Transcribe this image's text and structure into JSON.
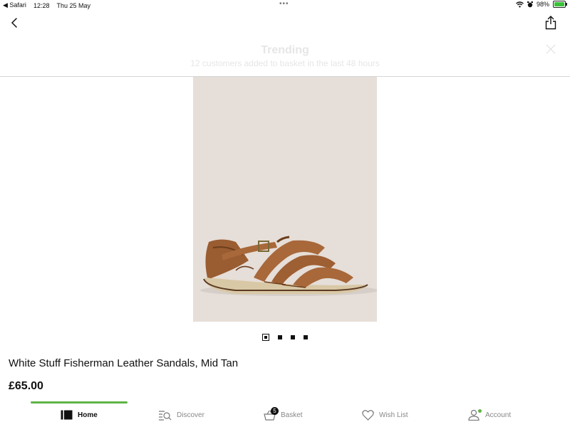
{
  "status_bar": {
    "back_app": "◀ Safari",
    "time": "12:28",
    "date": "Thu 25 May",
    "multitask": "•••",
    "battery": "98%",
    "battery_level": 0.98
  },
  "trending": {
    "title": "Trending",
    "subtitle": "12 customers added to basket in the last 48 hours"
  },
  "carousel": {
    "total": 4,
    "active_index": 0
  },
  "product": {
    "title": "White Stuff Fisherman Leather Sandals, Mid Tan",
    "price": "£65.00"
  },
  "tabs": [
    {
      "label": "Home",
      "icon": "home-icon",
      "active": true
    },
    {
      "label": "Discover",
      "icon": "discover-icon",
      "active": false
    },
    {
      "label": "Basket",
      "icon": "basket-icon",
      "active": false,
      "badge": "5"
    },
    {
      "label": "Wish List",
      "icon": "heart-icon",
      "active": false
    },
    {
      "label": "Account",
      "icon": "account-icon",
      "active": false
    }
  ],
  "colors": {
    "accent_green": "#5fb346",
    "image_bg": "#e6ded8",
    "leather": "#a8683a"
  }
}
